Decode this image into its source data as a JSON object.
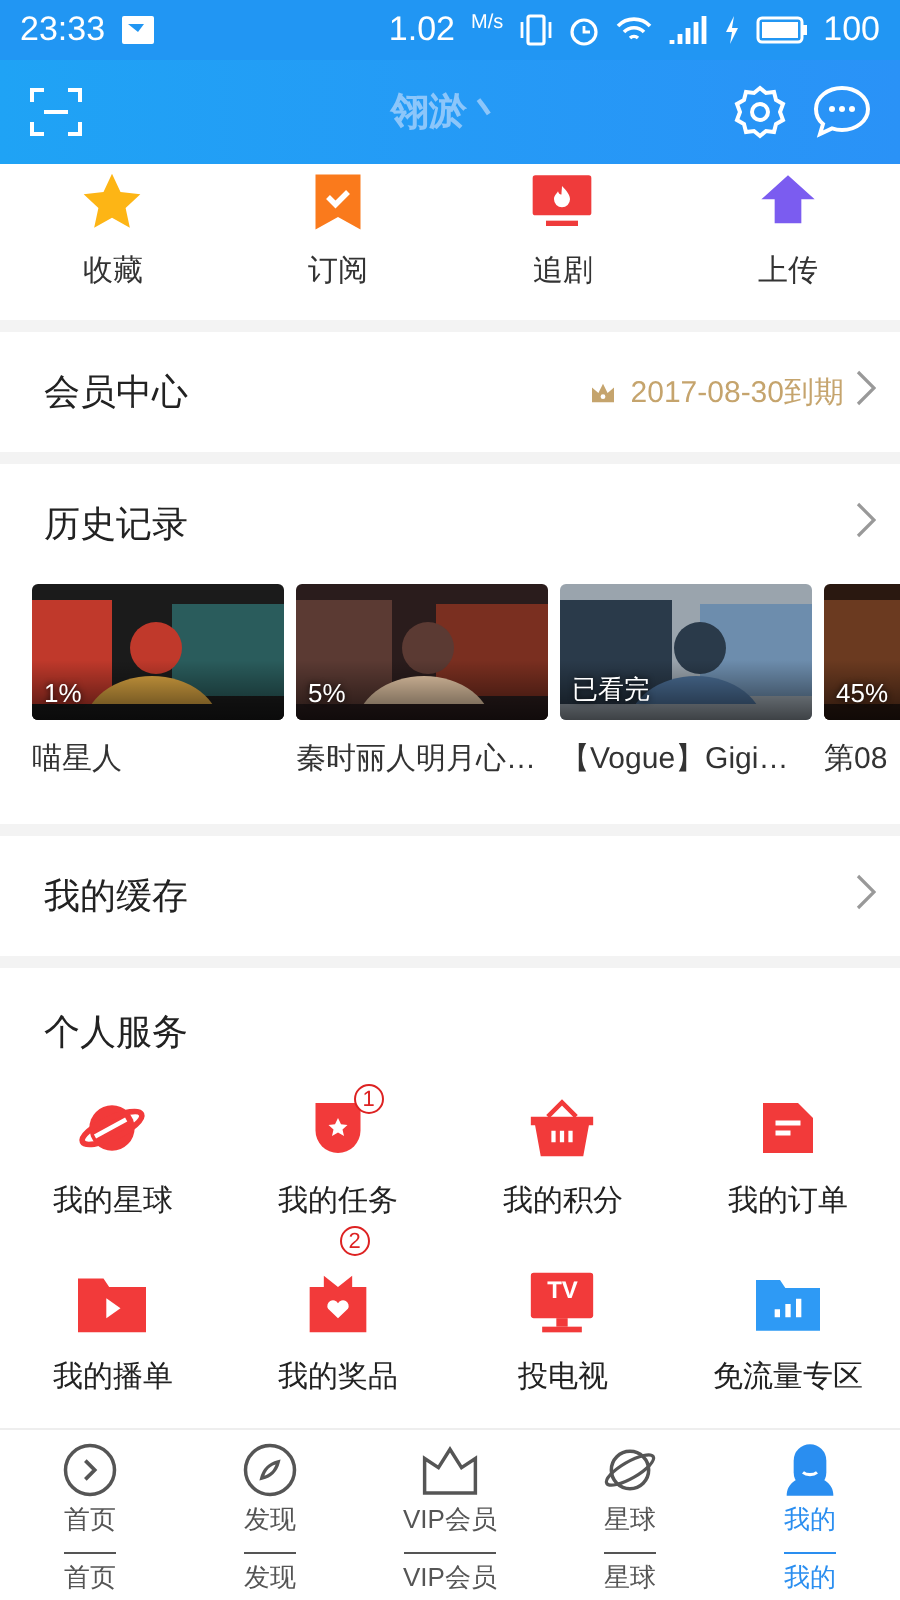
{
  "status_bar": {
    "time": "23:33",
    "speed": "1.02",
    "speed_unit": "M/s",
    "battery": "100"
  },
  "header": {
    "title": "翎淤丶"
  },
  "quick_actions": [
    {
      "label": "收藏",
      "kind": "star"
    },
    {
      "label": "订阅",
      "kind": "bookmark"
    },
    {
      "label": "追剧",
      "kind": "tv"
    },
    {
      "label": "上传",
      "kind": "upload"
    }
  ],
  "membership": {
    "title": "会员中心",
    "expiry": "2017-08-30到期"
  },
  "history": {
    "title": "历史记录",
    "items": [
      {
        "progress": "1%",
        "title": "喵星人"
      },
      {
        "progress": "5%",
        "title": "秦时丽人明月心…"
      },
      {
        "progress": "已看完",
        "title": "【Vogue】Gigi…"
      },
      {
        "progress": "45%",
        "title": "第08"
      }
    ]
  },
  "cache": {
    "title": "我的缓存"
  },
  "services": {
    "title": "个人服务",
    "items": [
      {
        "label": "我的星球",
        "kind": "planet"
      },
      {
        "label": "我的任务",
        "kind": "shield",
        "annotation_marks": [
          "1",
          "2"
        ]
      },
      {
        "label": "我的积分",
        "kind": "basket"
      },
      {
        "label": "我的订单",
        "kind": "order"
      },
      {
        "label": "我的播单",
        "kind": "playlist"
      },
      {
        "label": "我的奖品",
        "kind": "gift"
      },
      {
        "label": "投电视",
        "kind": "tvcast",
        "icon_text": "TV"
      },
      {
        "label": "免流量专区",
        "kind": "freeflow"
      }
    ]
  },
  "tab_bar": {
    "items": [
      {
        "label": "首页",
        "label_echo": "首页",
        "kind": "home",
        "selected": false
      },
      {
        "label": "发现",
        "label_echo": "发现",
        "kind": "discover",
        "selected": false
      },
      {
        "label": "VIP会员",
        "label_echo": "VIP会员",
        "kind": "vip",
        "selected": false
      },
      {
        "label": "星球",
        "label_echo": "星球",
        "kind": "planet",
        "selected": false
      },
      {
        "label": "我的",
        "label_echo": "我的",
        "kind": "me",
        "selected": true
      }
    ]
  }
}
